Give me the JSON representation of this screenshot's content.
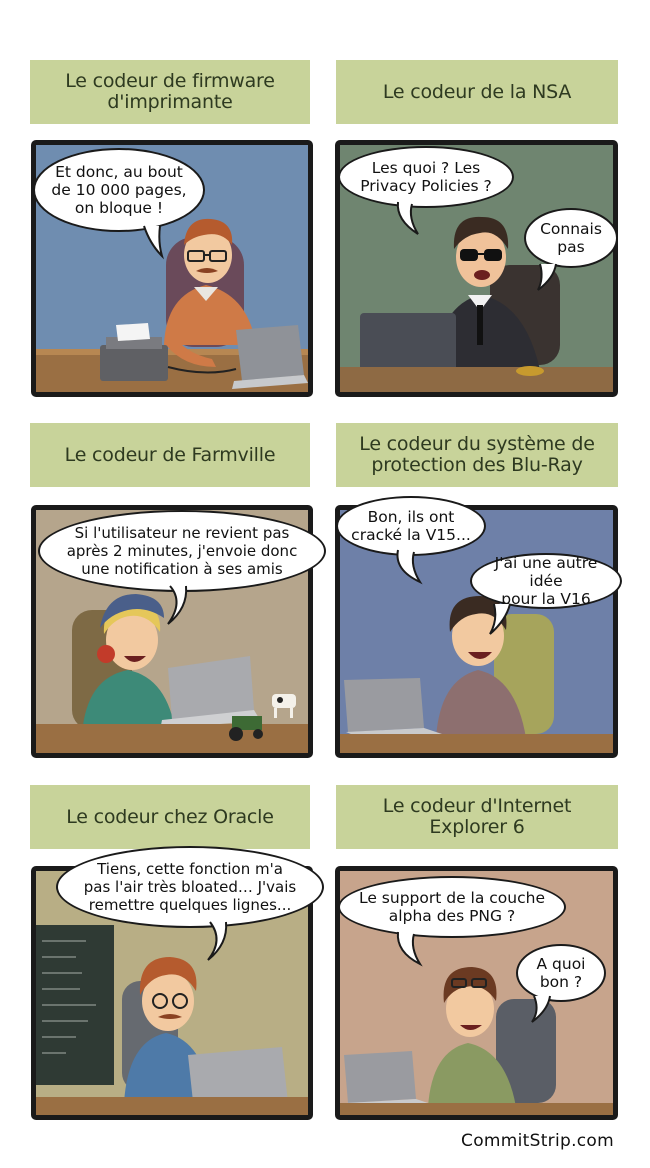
{
  "comic": {
    "signature": "CommitStrip.com",
    "colors": {
      "caption_bg": "#c8d39a",
      "panel_border": "#1a1a1a"
    },
    "panels": [
      {
        "caption": "Le codeur de firmware\nd'imprimante",
        "bubbles": [
          "Et donc, au bout\nde 10 000 pages,\non bloque !"
        ]
      },
      {
        "caption": "Le codeur de la NSA",
        "bubbles": [
          "Les quoi ? Les\nPrivacy Policies ?",
          "Connais\npas"
        ]
      },
      {
        "caption": "Le codeur de Farmville",
        "bubbles": [
          "Si l'utilisateur ne revient pas\naprès 2 minutes, j'envoie donc\nune notification à ses amis"
        ]
      },
      {
        "caption": "Le codeur du système de\nprotection des Blu-Ray",
        "bubbles": [
          "Bon, ils ont\ncracké la V15...",
          "J'ai une autre idée\npour la V16"
        ]
      },
      {
        "caption": "Le codeur chez Oracle",
        "bubbles": [
          "Tiens, cette fonction m'a\npas l'air très bloated… J'vais\nremettre quelques lignes..."
        ]
      },
      {
        "caption": "Le codeur d'Internet\nExplorer 6",
        "bubbles": [
          "Le support de la couche\nalpha des PNG ?",
          "A quoi\nbon ?"
        ]
      }
    ]
  }
}
